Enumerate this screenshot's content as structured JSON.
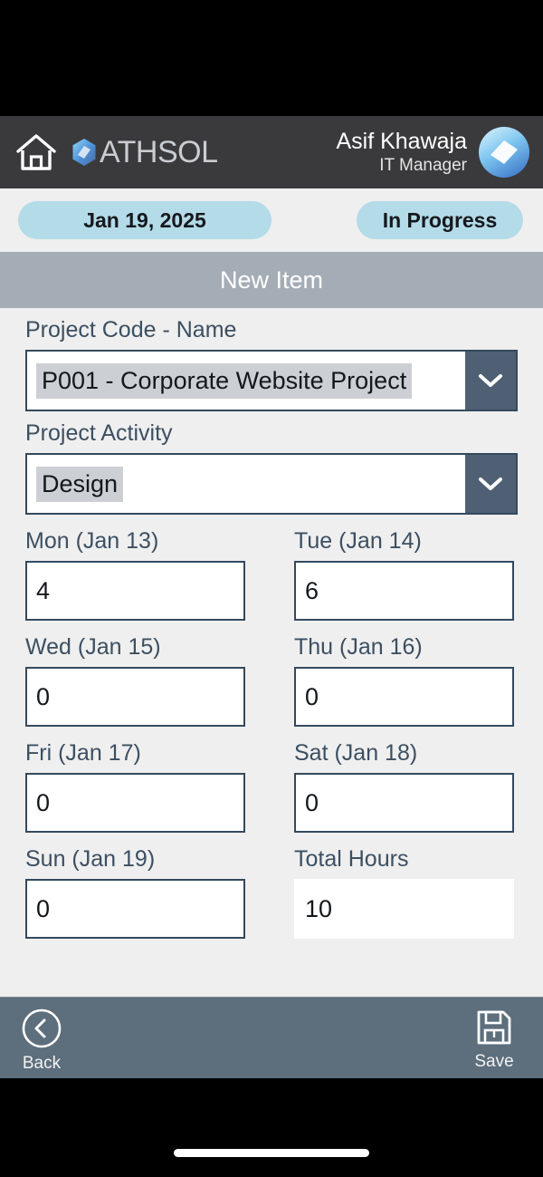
{
  "header": {
    "home_icon": "home-icon",
    "brand_name": "ATHSOL",
    "brand_mark_icon": "hexagon-logo-icon",
    "user_name": "Asif Khawaja",
    "user_role": "IT Manager",
    "avatar_icon": "user-avatar"
  },
  "meta": {
    "date_label": "Jan 19, 2025",
    "status_label": "In Progress"
  },
  "section": {
    "title": "New Item"
  },
  "form": {
    "project_code": {
      "label": "Project Code - Name",
      "value": "P001 - Corporate Website Project",
      "arrow_icon": "chevron-down-icon"
    },
    "project_activity": {
      "label": "Project Activity",
      "value": "Design",
      "arrow_icon": "chevron-down-icon"
    },
    "days": [
      {
        "label": "Mon (Jan 13)",
        "value": "4"
      },
      {
        "label": "Tue (Jan 14)",
        "value": "6"
      },
      {
        "label": "Wed (Jan 15)",
        "value": "0"
      },
      {
        "label": "Thu (Jan 16)",
        "value": "0"
      },
      {
        "label": "Fri (Jan 17)",
        "value": "0"
      },
      {
        "label": "Sat (Jan 18)",
        "value": "0"
      },
      {
        "label": "Sun (Jan 19)",
        "value": "0"
      },
      {
        "label": "Total Hours",
        "value": "10"
      }
    ]
  },
  "bottom_bar": {
    "back_label": "Back",
    "back_icon": "chevron-left-circle-icon",
    "save_label": "Save",
    "save_icon": "floppy-disk-icon"
  },
  "colors": {
    "header_bg": "#3a3a3c",
    "page_bg": "#efefef",
    "band_bg": "#a4adb6",
    "pill_bg": "#b3dbe8",
    "accent_slate": "#4f6074",
    "bottom_bar_bg": "#5d6e7c",
    "border": "#34495d",
    "label_text": "#3c4f62"
  }
}
